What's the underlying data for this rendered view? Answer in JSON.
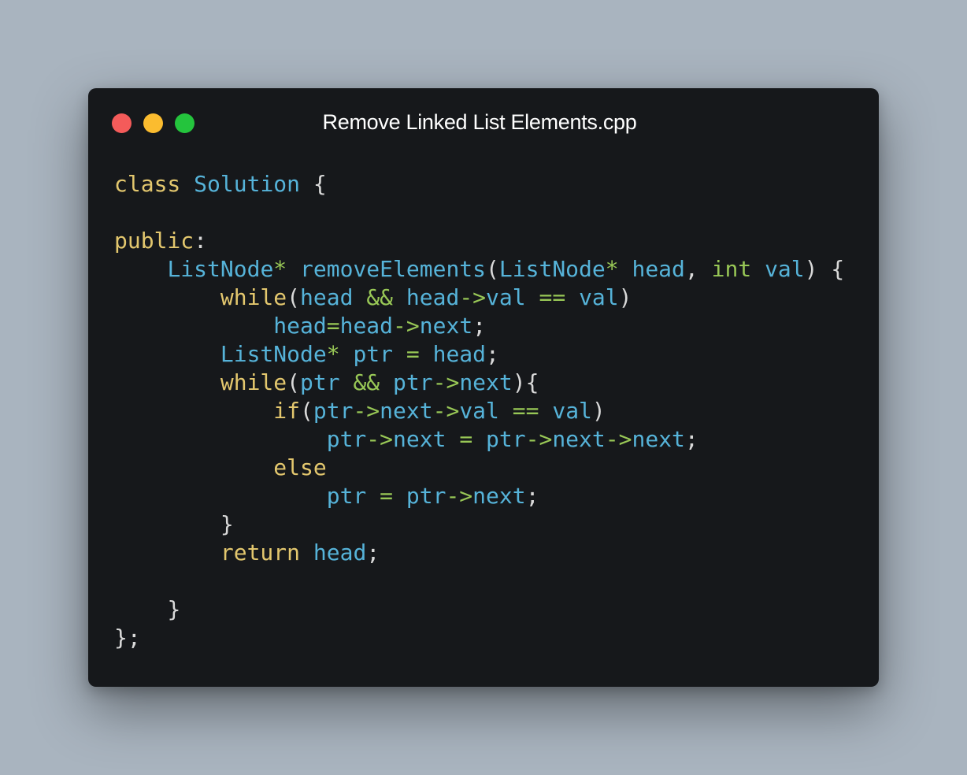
{
  "window": {
    "title": "Remove Linked List Elements.cpp",
    "controls": [
      {
        "name": "close-button",
        "color": "#f45b5a"
      },
      {
        "name": "minimize-button",
        "color": "#fbbc2f"
      },
      {
        "name": "zoom-button",
        "color": "#24c43d"
      }
    ]
  },
  "colors": {
    "keyword": "#e3c76e",
    "type": "#56b3d9",
    "identifier": "#56b3d9",
    "operator": "#98c756",
    "punctuation": "#d9d9d9",
    "background": "#16181b",
    "page_background": "#a9b4bf"
  },
  "code": {
    "lines": [
      [
        [
          "class",
          "kw"
        ],
        [
          " ",
          "p"
        ],
        [
          "Solution",
          "id"
        ],
        [
          " {",
          "p"
        ]
      ],
      [],
      [
        [
          "public",
          "kw"
        ],
        [
          ":",
          "p"
        ]
      ],
      [
        [
          "    ",
          "p"
        ],
        [
          "ListNode",
          "id"
        ],
        [
          "*",
          "op"
        ],
        [
          " ",
          "p"
        ],
        [
          "removeElements",
          "id"
        ],
        [
          "(",
          "p"
        ],
        [
          "ListNode",
          "id"
        ],
        [
          "*",
          "op"
        ],
        [
          " ",
          "p"
        ],
        [
          "head",
          "id"
        ],
        [
          ", ",
          "p"
        ],
        [
          "int",
          "op"
        ],
        [
          " ",
          "p"
        ],
        [
          "val",
          "id"
        ],
        [
          ") {",
          "p"
        ]
      ],
      [
        [
          "        ",
          "p"
        ],
        [
          "while",
          "kw"
        ],
        [
          "(",
          "p"
        ],
        [
          "head",
          "id"
        ],
        [
          " ",
          "p"
        ],
        [
          "&&",
          "op"
        ],
        [
          " ",
          "p"
        ],
        [
          "head",
          "id"
        ],
        [
          "->",
          "op"
        ],
        [
          "val",
          "id"
        ],
        [
          " ",
          "p"
        ],
        [
          "==",
          "op"
        ],
        [
          " ",
          "p"
        ],
        [
          "val",
          "id"
        ],
        [
          ")",
          "p"
        ]
      ],
      [
        [
          "            ",
          "p"
        ],
        [
          "head",
          "id"
        ],
        [
          "=",
          "op"
        ],
        [
          "head",
          "id"
        ],
        [
          "->",
          "op"
        ],
        [
          "next",
          "id"
        ],
        [
          ";",
          "p"
        ]
      ],
      [
        [
          "        ",
          "p"
        ],
        [
          "ListNode",
          "id"
        ],
        [
          "*",
          "op"
        ],
        [
          " ",
          "p"
        ],
        [
          "ptr",
          "id"
        ],
        [
          " ",
          "p"
        ],
        [
          "=",
          "op"
        ],
        [
          " ",
          "p"
        ],
        [
          "head",
          "id"
        ],
        [
          ";",
          "p"
        ]
      ],
      [
        [
          "        ",
          "p"
        ],
        [
          "while",
          "kw"
        ],
        [
          "(",
          "p"
        ],
        [
          "ptr",
          "id"
        ],
        [
          " ",
          "p"
        ],
        [
          "&&",
          "op"
        ],
        [
          " ",
          "p"
        ],
        [
          "ptr",
          "id"
        ],
        [
          "->",
          "op"
        ],
        [
          "next",
          "id"
        ],
        [
          "){",
          "p"
        ]
      ],
      [
        [
          "            ",
          "p"
        ],
        [
          "if",
          "kw"
        ],
        [
          "(",
          "p"
        ],
        [
          "ptr",
          "id"
        ],
        [
          "->",
          "op"
        ],
        [
          "next",
          "id"
        ],
        [
          "->",
          "op"
        ],
        [
          "val",
          "id"
        ],
        [
          " ",
          "p"
        ],
        [
          "==",
          "op"
        ],
        [
          " ",
          "p"
        ],
        [
          "val",
          "id"
        ],
        [
          ")",
          "p"
        ]
      ],
      [
        [
          "                ",
          "p"
        ],
        [
          "ptr",
          "id"
        ],
        [
          "->",
          "op"
        ],
        [
          "next",
          "id"
        ],
        [
          " ",
          "p"
        ],
        [
          "=",
          "op"
        ],
        [
          " ",
          "p"
        ],
        [
          "ptr",
          "id"
        ],
        [
          "->",
          "op"
        ],
        [
          "next",
          "id"
        ],
        [
          "->",
          "op"
        ],
        [
          "next",
          "id"
        ],
        [
          ";",
          "p"
        ]
      ],
      [
        [
          "            ",
          "p"
        ],
        [
          "else",
          "kw"
        ]
      ],
      [
        [
          "                ",
          "p"
        ],
        [
          "ptr",
          "id"
        ],
        [
          " ",
          "p"
        ],
        [
          "=",
          "op"
        ],
        [
          " ",
          "p"
        ],
        [
          "ptr",
          "id"
        ],
        [
          "->",
          "op"
        ],
        [
          "next",
          "id"
        ],
        [
          ";",
          "p"
        ]
      ],
      [
        [
          "        ",
          "p"
        ],
        [
          "}",
          "p"
        ]
      ],
      [
        [
          "        ",
          "p"
        ],
        [
          "return",
          "kw"
        ],
        [
          " ",
          "p"
        ],
        [
          "head",
          "id"
        ],
        [
          ";",
          "p"
        ]
      ],
      [],
      [
        [
          "    ",
          "p"
        ],
        [
          "}",
          "p"
        ]
      ],
      [
        [
          "};",
          "p"
        ]
      ]
    ]
  }
}
